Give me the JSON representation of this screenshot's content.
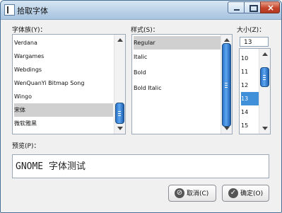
{
  "window": {
    "title": "拾取字体"
  },
  "labels": {
    "family": "字体族(Y)：",
    "style": "样式(S)：",
    "size": "大小(Z)：",
    "preview": "预览(P)："
  },
  "families": [
    "Verdana",
    "Wargames",
    "Webdings",
    "WenQuanYi Bitmap Song",
    "Wingo",
    "宋体",
    "微软雅黑"
  ],
  "styles": [
    "Regular",
    "Italic",
    "Bold",
    "Bold Italic"
  ],
  "sizes": [
    "10",
    "11",
    "12",
    "13",
    "14",
    "15"
  ],
  "size_value": "13",
  "preview_text": "GNOME 字体测试",
  "buttons": {
    "cancel": "取消(C)",
    "ok": "确定(O)"
  },
  "icons": {
    "app": "app-icon",
    "cancel": "cancel-icon",
    "ok": "ok-icon"
  }
}
